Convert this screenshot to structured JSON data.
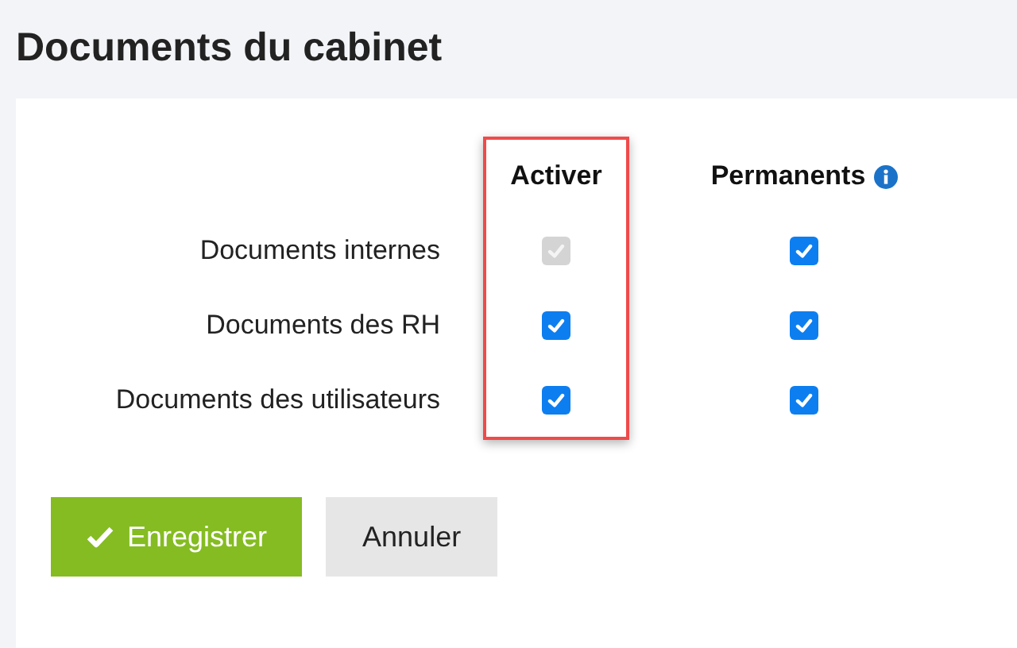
{
  "title": "Documents du cabinet",
  "columns": [
    {
      "label": "Activer",
      "highlighted": true,
      "info": false
    },
    {
      "label": "Permanents",
      "highlighted": false,
      "info": true
    }
  ],
  "rows": [
    {
      "label": "Documents internes",
      "activer": {
        "checked": true,
        "disabled": true
      },
      "permanent": {
        "checked": true,
        "disabled": false
      }
    },
    {
      "label": "Documents des RH",
      "activer": {
        "checked": true,
        "disabled": false
      },
      "permanent": {
        "checked": true,
        "disabled": false
      }
    },
    {
      "label": "Documents des utilisateurs",
      "activer": {
        "checked": true,
        "disabled": false
      },
      "permanent": {
        "checked": true,
        "disabled": false
      }
    }
  ],
  "buttons": [
    {
      "label": "Enregistrer",
      "kind": "primary"
    },
    {
      "label": "Annuler",
      "kind": "secondary"
    }
  ]
}
